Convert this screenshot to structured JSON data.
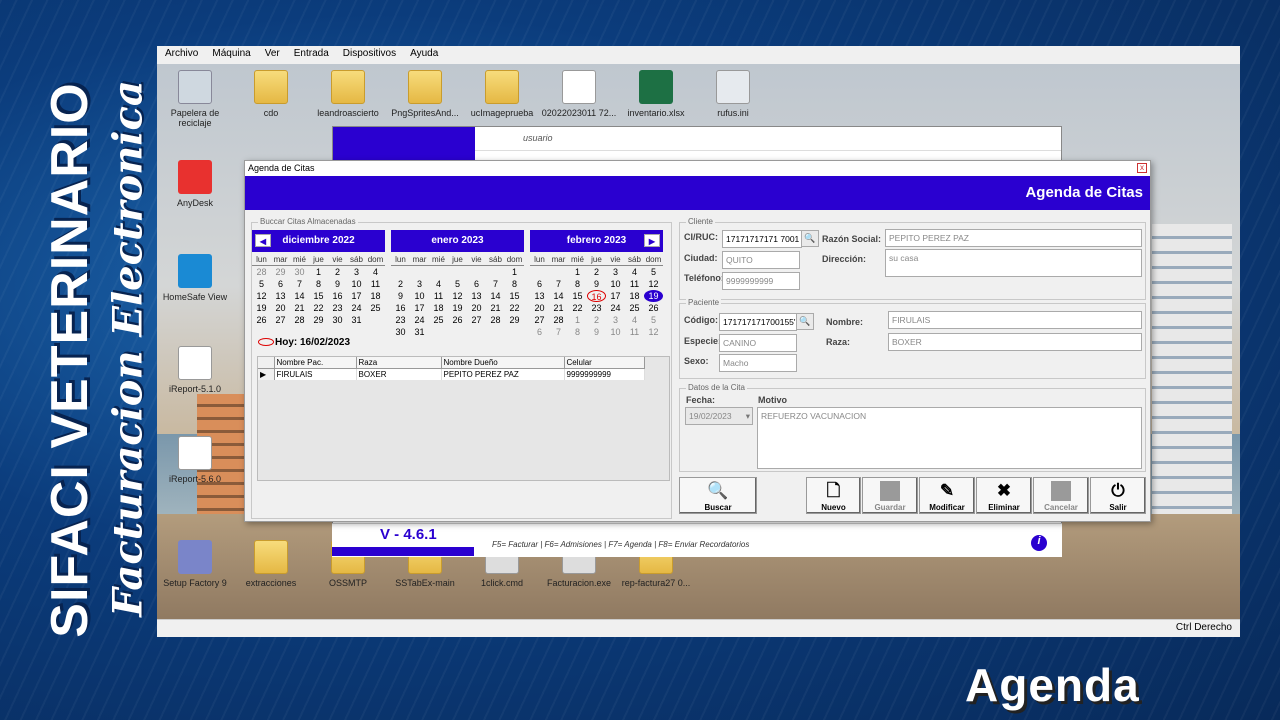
{
  "overlay": {
    "brand_line1": "SIFACI VETERINARIO",
    "brand_line2": "Facturacion Electronica",
    "caption": "Agenda"
  },
  "vm": {
    "menu": [
      "Archivo",
      "Máquina",
      "Ver",
      "Entrada",
      "Dispositivos",
      "Ayuda"
    ],
    "status_text": "Ctrl Derecho",
    "desktop_icons": [
      {
        "label": "Papelera de reciclaje"
      },
      {
        "label": "cdo"
      },
      {
        "label": "leandroascierto"
      },
      {
        "label": "PngSpritesAnd..."
      },
      {
        "label": "ucImageprueba"
      },
      {
        "label": "02022023011 72..."
      },
      {
        "label": "inventario.xlsx"
      },
      {
        "label": "rufus.ini"
      },
      {
        "label": "AnyDesk"
      },
      {
        "label": "HomeSafe View"
      },
      {
        "label": "iReport-5.1.0"
      },
      {
        "label": "iReport-5.6.0"
      },
      {
        "label": "Setup Factory 9"
      },
      {
        "label": "extracciones"
      },
      {
        "label": "OSSMTP"
      },
      {
        "label": "SSTabEx-main"
      },
      {
        "label": "1click.cmd"
      },
      {
        "label": "Facturacion.exe"
      },
      {
        "label": "rep-factura27 0..."
      }
    ]
  },
  "back": {
    "user_placeholder": "usuario",
    "version": "V - 4.6.1",
    "fkeys": "F5= Facturar | F6= Admisiones | F7= Agenda | F8= Enviar Recordatorios",
    "info": "i"
  },
  "dialog": {
    "title": "Agenda de Citas",
    "banner": "Agenda de Citas",
    "close": "x",
    "calendar_group": "Buccar Citas Almacenadas",
    "weekdays": [
      "lun",
      "mar",
      "mié",
      "jue",
      "vie",
      "sáb",
      "dom"
    ],
    "months": [
      {
        "name": "diciembre 2022",
        "days": [
          [
            "28",
            "o"
          ],
          [
            "29",
            "o"
          ],
          [
            "30",
            "o"
          ],
          [
            "1",
            ""
          ],
          [
            "2",
            ""
          ],
          [
            "3",
            ""
          ],
          [
            "4",
            ""
          ],
          [
            "5",
            ""
          ],
          [
            "6",
            ""
          ],
          [
            "7",
            ""
          ],
          [
            "8",
            ""
          ],
          [
            "9",
            ""
          ],
          [
            "10",
            ""
          ],
          [
            "11",
            ""
          ],
          [
            "12",
            ""
          ],
          [
            "13",
            ""
          ],
          [
            "14",
            ""
          ],
          [
            "15",
            ""
          ],
          [
            "16",
            ""
          ],
          [
            "17",
            ""
          ],
          [
            "18",
            ""
          ],
          [
            "19",
            ""
          ],
          [
            "20",
            ""
          ],
          [
            "21",
            ""
          ],
          [
            "22",
            ""
          ],
          [
            "23",
            ""
          ],
          [
            "24",
            ""
          ],
          [
            "25",
            ""
          ],
          [
            "26",
            ""
          ],
          [
            "27",
            ""
          ],
          [
            "28",
            ""
          ],
          [
            "29",
            ""
          ],
          [
            "30",
            ""
          ],
          [
            "31",
            ""
          ]
        ]
      },
      {
        "name": "enero 2023",
        "days": [
          [
            "",
            ""
          ],
          [
            "",
            ""
          ],
          [
            "",
            ""
          ],
          [
            "",
            ""
          ],
          [
            "",
            ""
          ],
          [
            "",
            ""
          ],
          [
            "1",
            ""
          ],
          [
            "2",
            ""
          ],
          [
            "3",
            ""
          ],
          [
            "4",
            ""
          ],
          [
            "5",
            ""
          ],
          [
            "6",
            ""
          ],
          [
            "7",
            ""
          ],
          [
            "8",
            ""
          ],
          [
            "9",
            ""
          ],
          [
            "10",
            ""
          ],
          [
            "11",
            ""
          ],
          [
            "12",
            ""
          ],
          [
            "13",
            ""
          ],
          [
            "14",
            ""
          ],
          [
            "15",
            ""
          ],
          [
            "16",
            ""
          ],
          [
            "17",
            ""
          ],
          [
            "18",
            ""
          ],
          [
            "19",
            ""
          ],
          [
            "20",
            ""
          ],
          [
            "21",
            ""
          ],
          [
            "22",
            ""
          ],
          [
            "23",
            ""
          ],
          [
            "24",
            ""
          ],
          [
            "25",
            ""
          ],
          [
            "26",
            ""
          ],
          [
            "27",
            ""
          ],
          [
            "28",
            ""
          ],
          [
            "29",
            ""
          ],
          [
            "30",
            ""
          ],
          [
            "31",
            ""
          ]
        ]
      },
      {
        "name": "febrero 2023",
        "days": [
          [
            "",
            ""
          ],
          [
            "",
            ""
          ],
          [
            "1",
            ""
          ],
          [
            "2",
            ""
          ],
          [
            "3",
            ""
          ],
          [
            "4",
            ""
          ],
          [
            "5",
            ""
          ],
          [
            "6",
            ""
          ],
          [
            "7",
            ""
          ],
          [
            "8",
            ""
          ],
          [
            "9",
            ""
          ],
          [
            "10",
            ""
          ],
          [
            "11",
            ""
          ],
          [
            "12",
            ""
          ],
          [
            "13",
            ""
          ],
          [
            "14",
            ""
          ],
          [
            "15",
            ""
          ],
          [
            "16",
            "today"
          ],
          [
            "17",
            ""
          ],
          [
            "18",
            ""
          ],
          [
            "19",
            "sel"
          ],
          [
            "20",
            ""
          ],
          [
            "21",
            ""
          ],
          [
            "22",
            ""
          ],
          [
            "23",
            ""
          ],
          [
            "24",
            ""
          ],
          [
            "25",
            ""
          ],
          [
            "26",
            ""
          ],
          [
            "27",
            ""
          ],
          [
            "28",
            ""
          ],
          [
            "1",
            "o"
          ],
          [
            "2",
            "o"
          ],
          [
            "3",
            "o"
          ],
          [
            "4",
            "o"
          ],
          [
            "5",
            "o"
          ],
          [
            "6",
            "o"
          ],
          [
            "7",
            "o"
          ],
          [
            "8",
            "o"
          ],
          [
            "9",
            "o"
          ],
          [
            "10",
            "o"
          ],
          [
            "11",
            "o"
          ],
          [
            "12",
            "o"
          ]
        ]
      }
    ],
    "today_label": "Hoy: 16/02/2023",
    "table": {
      "headers": [
        "Nombre Pac.",
        "Raza",
        "Nombre Dueño",
        "Celular"
      ],
      "rows": [
        [
          "FIRULAIS",
          "BOXER",
          "PEPITO PEREZ PAZ",
          "9999999999"
        ]
      ]
    },
    "cliente": {
      "group": "Cliente",
      "ci_label": "CI/RUC:",
      "ci": "17171717171 7001",
      "razon_label": "Razón Social:",
      "razon": "PEPITO PEREZ PAZ",
      "ciudad_label": "Ciudad:",
      "ciudad": "QUITO",
      "direccion_label": "Dirección:",
      "direccion": "su casa",
      "telefono_label": "Teléfono:",
      "telefono": "9999999999"
    },
    "paciente": {
      "group": "Paciente",
      "codigo_label": "Código:",
      "codigo": "171717171700155'",
      "nombre_label": "Nombre:",
      "nombre": "FIRULAIS",
      "especie_label": "Especie:",
      "especie": "CANINO",
      "raza_label": "Raza:",
      "raza": "BOXER",
      "sexo_label": "Sexo:",
      "sexo": "Macho"
    },
    "cita": {
      "group": "Datos de la Cita",
      "fecha_label": "Fecha:",
      "fecha": "19/02/2023",
      "motivo_label": "Motivo",
      "motivo": "REFUERZO VACUNACION"
    },
    "buttons": {
      "buscar": "Buscar",
      "nuevo": "Nuevo",
      "guardar": "Guardar",
      "modificar": "Modificar",
      "eliminar": "Eliminar",
      "cancelar": "Cancelar",
      "salir": "Salir"
    }
  }
}
